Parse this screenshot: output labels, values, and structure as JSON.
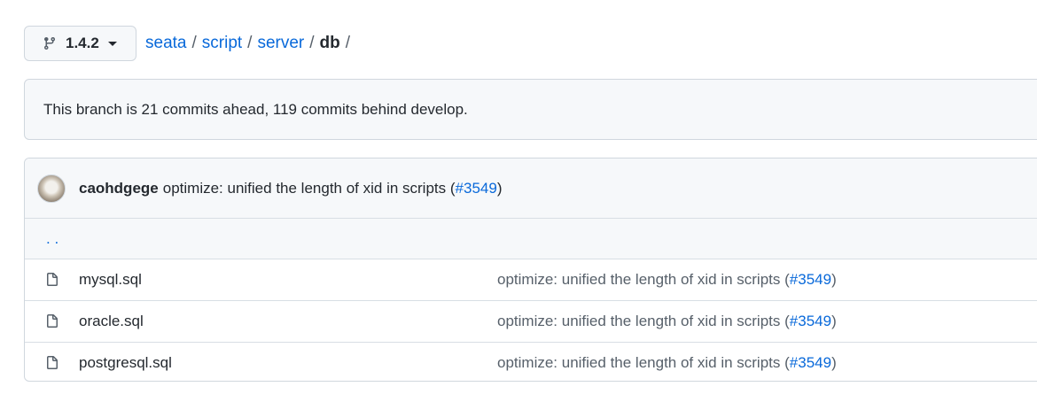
{
  "branch": {
    "name": "1.4.2"
  },
  "breadcrumb": {
    "items": [
      "seata",
      "script",
      "server"
    ],
    "current": "db",
    "separator": "/"
  },
  "status": {
    "text": "This branch is 21 commits ahead, 119 commits behind develop."
  },
  "latest_commit": {
    "author": "caohdgege",
    "message": "optimize: unified the length of xid in scripts",
    "pr": "#3549"
  },
  "updir": {
    "label": ". ."
  },
  "files": [
    {
      "name": "mysql.sql",
      "message": "optimize: unified the length of xid in scripts",
      "pr": "#3549"
    },
    {
      "name": "oracle.sql",
      "message": "optimize: unified the length of xid in scripts",
      "pr": "#3549"
    },
    {
      "name": "postgresql.sql",
      "message": "optimize: unified the length of xid in scripts",
      "pr": "#3549"
    }
  ],
  "icons": {
    "branch": "git-branch-icon",
    "file": "file-icon",
    "caret": "caret-down-icon"
  },
  "colors": {
    "link": "#0969da",
    "border": "#d0d7de",
    "subtle_bg": "#f6f8fa",
    "muted_text": "#57606a"
  }
}
